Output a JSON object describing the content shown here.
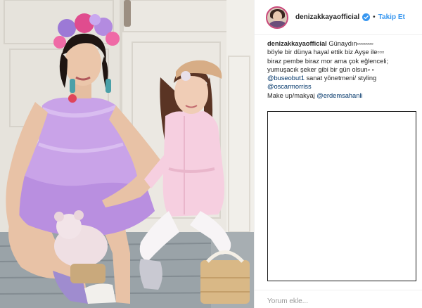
{
  "header": {
    "username": "denizakkayaofficial",
    "separator": "•",
    "follow_label": "Takip Et"
  },
  "caption": {
    "username": "denizakkayaofficial",
    "lines": [
      "Günaydın▫▫▫▫▫▫▫",
      "böyle bir dünya hayal ettik biz Ayşe ile▫▫▫",
      "biraz pembe biraz mor ama çok eğlenceli;",
      "yumuşacık şeker gibi bir gün olsun▫ ▫"
    ],
    "mention_1": "@buseobut1",
    "credit_text": " sanat yönetmeni/ styling",
    "mention_2": "@oscarmorriss",
    "makeup_label": "Make up/makyaj ",
    "mention_3": "@erdemsahanli"
  },
  "comment": {
    "placeholder": "Yorum ekle..."
  },
  "colors": {
    "accent": "#3897f0",
    "mention": "#003569",
    "text": "#262626",
    "placeholder": "#999999"
  },
  "icons": {
    "verified": "verified-badge-icon"
  }
}
